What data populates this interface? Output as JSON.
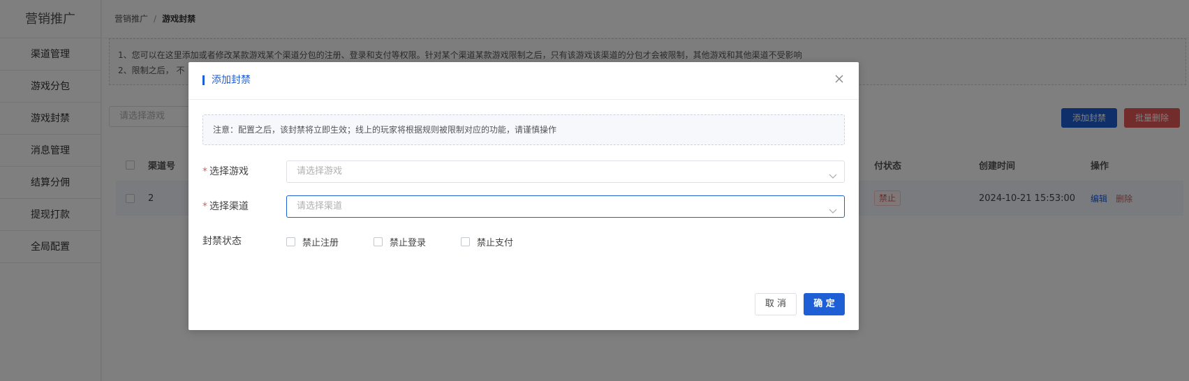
{
  "sidebar": {
    "brand": "营销推广",
    "items": [
      {
        "label": "渠道管理"
      },
      {
        "label": "游戏分包"
      },
      {
        "label": "游戏封禁"
      },
      {
        "label": "消息管理"
      },
      {
        "label": "结算分佣"
      },
      {
        "label": "提现打款"
      },
      {
        "label": "全局配置"
      }
    ]
  },
  "breadcrumb": {
    "root": "营销推广",
    "separator": "/",
    "current": "游戏封禁"
  },
  "tips": {
    "line1": "1、您可以在这里添加或者修改某款游戏某个渠道分包的注册、登录和支付等权限。针对某个渠道某款游戏限制之后，只有该游戏该渠道的分包才会被限制，其他游戏和其他渠道不受影响",
    "line2": "2、限制之后，  不"
  },
  "filter": {
    "game_placeholder": "请选择游戏"
  },
  "toolbar": {
    "add_label": "添加封禁",
    "batch_delete_label": "批量删除"
  },
  "table": {
    "headers": {
      "channel_no": "渠道号",
      "pay_status": "付状态",
      "created_at": "创建时间",
      "actions": "操作"
    },
    "rows": [
      {
        "channel_no": "2",
        "pay_status": "禁止",
        "created_at": "2024-10-21 15:53:00",
        "edit": "编辑",
        "delete": "删除"
      }
    ]
  },
  "dialog": {
    "title": "添加封禁",
    "notice": "注意：配置之后，该封禁将立即生效；线上的玩家将根据规则被限制对应的功能，请谨慎操作",
    "game_label": "选择游戏",
    "game_placeholder": "请选择游戏",
    "channel_label": "选择渠道",
    "channel_placeholder": "请选择渠道",
    "status_label": "封禁状态",
    "options": [
      {
        "label": "禁止注册",
        "checked": false
      },
      {
        "label": "禁止登录",
        "checked": false
      },
      {
        "label": "禁止支付",
        "checked": false
      }
    ],
    "cancel_label": "取 消",
    "ok_label": "确 定"
  },
  "colors": {
    "primary": "#1e5fd6",
    "danger": "#e45858",
    "overlay": "rgba(0,0,0,0.5)"
  }
}
